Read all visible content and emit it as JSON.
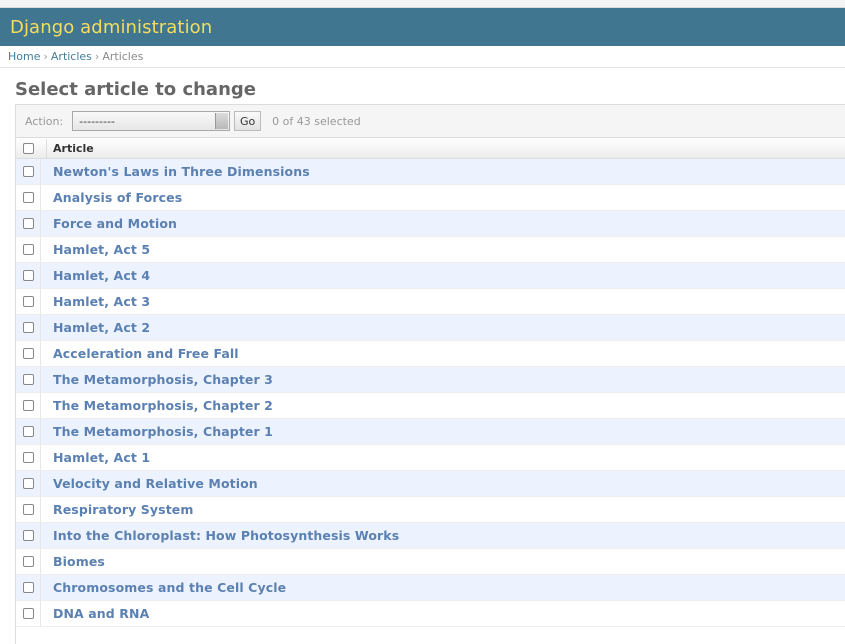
{
  "header": {
    "title": "Django administration"
  },
  "breadcrumbs": {
    "home": "Home",
    "app": "Articles",
    "current": "Articles",
    "separator": "›"
  },
  "page": {
    "title": "Select article to change"
  },
  "actions": {
    "label": "Action:",
    "selected_value": "---------",
    "go_label": "Go",
    "counter": "0 of 43 selected"
  },
  "table": {
    "column_header": "Article",
    "rows": [
      "Newton's Laws in Three Dimensions",
      "Analysis of Forces",
      "Force and Motion",
      "Hamlet, Act 5",
      "Hamlet, Act 4",
      "Hamlet, Act 3",
      "Hamlet, Act 2",
      "Acceleration and Free Fall",
      "The Metamorphosis, Chapter 3",
      "The Metamorphosis, Chapter 2",
      "The Metamorphosis, Chapter 1",
      "Hamlet, Act 1",
      "Velocity and Relative Motion",
      "Respiratory System",
      "Into the Chloroplast: How Photosynthesis Works",
      "Biomes",
      "Chromosomes and the Cell Cycle",
      "DNA and RNA"
    ]
  },
  "colors": {
    "header_bg": "#417690",
    "brand": "#f5dd5d",
    "link": "#5b80b2",
    "row_alt": "#edf3fe"
  }
}
